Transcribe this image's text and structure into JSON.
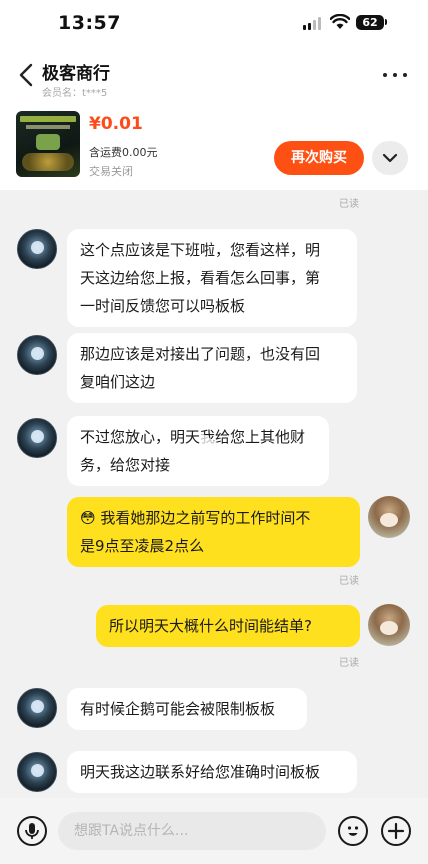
{
  "status_bar": {
    "time": "13:57",
    "battery": "62"
  },
  "header": {
    "shop_name": "极客商行",
    "member_label": "会员名：t***5"
  },
  "order": {
    "price": "¥0.01",
    "shipping": "含运费0.00元",
    "status": "交易关闭",
    "rebuy_label": "再次购买"
  },
  "chat": {
    "read_top": "已读",
    "messages": [
      {
        "side": "left",
        "text_lines": [
          "这个点应该是下班啦，您看这样，明",
          "天这边给您上报，看看怎么回事，第",
          "一时间反馈您可以吗板板"
        ]
      },
      {
        "side": "left",
        "text_lines": [
          "那边应该是对接出了问题，也没有回",
          "复咱们这边"
        ]
      },
      {
        "side": "left",
        "text_lines": [
          "不过您放心，明天我给您上其他财",
          "务，给您对接"
        ]
      },
      {
        "side": "right",
        "emoji": "😳",
        "text_lines": [
          "我看她那边之前写的工作时间不",
          "是9点至凌晨2点么"
        ],
        "read": "已读"
      },
      {
        "side": "right",
        "text_lines": [
          "所以明天大概什么时间能结单?"
        ],
        "read": "已读"
      },
      {
        "side": "left",
        "text_lines": [
          "有时候企鹅可能会被限制板板"
        ]
      },
      {
        "side": "left",
        "text_lines": [
          "明天我这边联系好给您准确时间板板"
        ]
      }
    ]
  },
  "input": {
    "placeholder": "想跟TA说点什么..."
  },
  "colors": {
    "accent": "#ff5014",
    "price": "#ff4a1a",
    "my_bubble": "#ffe01f"
  },
  "icons": [
    "back-chevron-icon",
    "more-icon",
    "chevron-down-icon",
    "voice-icon",
    "emoji-icon",
    "plus-icon",
    "play-icon"
  ]
}
